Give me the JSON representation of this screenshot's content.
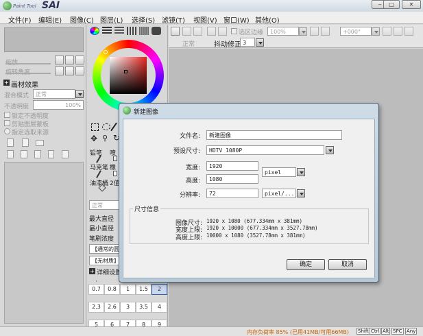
{
  "app": {
    "logo_text": "Paint Tool",
    "logo_name": "SAI"
  },
  "titlebar": {
    "minimize": "‒",
    "restore": "□",
    "close": "✕"
  },
  "menu": [
    {
      "label": "文件(F)"
    },
    {
      "label": "编辑(E)"
    },
    {
      "label": "图像(C)"
    },
    {
      "label": "图层(L)"
    },
    {
      "label": "选择(S)"
    },
    {
      "label": "滤镜(T)"
    },
    {
      "label": "视图(V)"
    },
    {
      "label": "窗口(W)"
    },
    {
      "label": "其他(O)"
    }
  ],
  "toolbar": {
    "select_edge_label": "选区边缘",
    "zoom_value": "100%",
    "rotate_value": "+000°",
    "mode_value": "正常",
    "stabilizer_label": "抖动修正",
    "stabilizer_value": "3"
  },
  "left_panel": {
    "layer_zoom_label": "缩放",
    "layer_rotate_label": "旋转角度",
    "effects_title": "画材效果",
    "blend_mode_label": "混合模式",
    "blend_mode_value": "正常",
    "opacity_label": "不透明度",
    "opacity_value": "100%",
    "lock_opacity": "锁定不透明度",
    "clip_layer": "剪贴图层蒙板",
    "source_ref": "指定选取来源"
  },
  "tools": {
    "pencil": "铅笔",
    "eraser_short": "喷",
    "marker": "马克笔",
    "eraser": "橡",
    "bucket": "油漆桶",
    "binary": "2值"
  },
  "brush_settings": {
    "mode_value": "正常",
    "max_size_label": "最大直径",
    "min_size_label": "最小直径",
    "density_label": "笔刷浓度",
    "shape_value": "【通常的圆",
    "texture_value": "【无材质】",
    "detail_label": "详细设置"
  },
  "brush_sizes": [
    [
      "0.7",
      "0.8",
      "1",
      "1.5",
      "2"
    ],
    [
      "2.3",
      "2.6",
      "3",
      "3.5",
      "4"
    ],
    [
      "5",
      "6",
      "7",
      "8",
      "9"
    ]
  ],
  "dialog": {
    "title": "新建图像",
    "filename_label": "文件名:",
    "filename_value": "新建图像",
    "preset_label": "预设尺寸:",
    "preset_value": "HDTV 1080P",
    "width_label": "宽度:",
    "width_value": "1920",
    "height_label": "高度:",
    "height_value": "1080",
    "unit_value": "pixel",
    "resolution_label": "分辨率:",
    "resolution_value": "72",
    "resolution_unit": "pixel/...",
    "info_group": "尺寸信息",
    "image_size_label": "图像尺寸:",
    "image_size_value": "1920 x 1080 (677.334mm x 381mm)",
    "width_limit_label": "宽度上限:",
    "width_limit_value": "1920 x 10000 (677.334mm x 3527.78mm)",
    "height_limit_label": "高度上限:",
    "height_limit_value": "10000 x 1080 (3527.78mm x 381mm)",
    "ok_label": "确定",
    "cancel_label": "取消"
  },
  "statusbar": {
    "memory": "内存负荷率 85% (已用41MB/可用66MB)",
    "keys": [
      "Shift",
      "Ctrl",
      "Alt",
      "SPC",
      "Any"
    ]
  },
  "colors": {
    "accent_blue": "#1e66b4",
    "status_orange": "#c86400",
    "canvas_gray": "#bcbcbc"
  }
}
